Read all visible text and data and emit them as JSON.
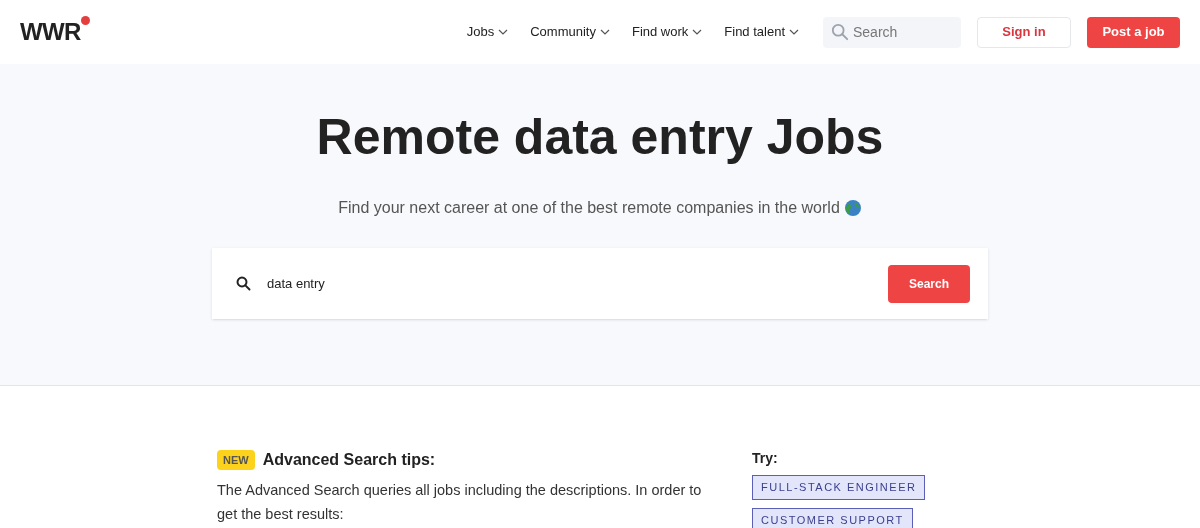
{
  "logo": {
    "text": "WWR"
  },
  "nav": [
    {
      "label": "Jobs"
    },
    {
      "label": "Community"
    },
    {
      "label": "Find work"
    },
    {
      "label": "Find talent"
    }
  ],
  "header_search": {
    "placeholder": "Search"
  },
  "sign_in": "Sign in",
  "post_job": "Post a job",
  "hero": {
    "title": "Remote data entry Jobs",
    "subtitle": "Find your next career at one of the best remote companies in the world",
    "search": {
      "value": "data entry",
      "button": "Search"
    }
  },
  "tips": {
    "badge": "NEW",
    "title": "Advanced Search tips:",
    "text": "The Advanced Search queries all jobs including the descriptions. In order to get the best results:"
  },
  "try": {
    "label": "Try:",
    "tags": [
      "FULL-STACK ENGINEER",
      "CUSTOMER SUPPORT"
    ]
  }
}
